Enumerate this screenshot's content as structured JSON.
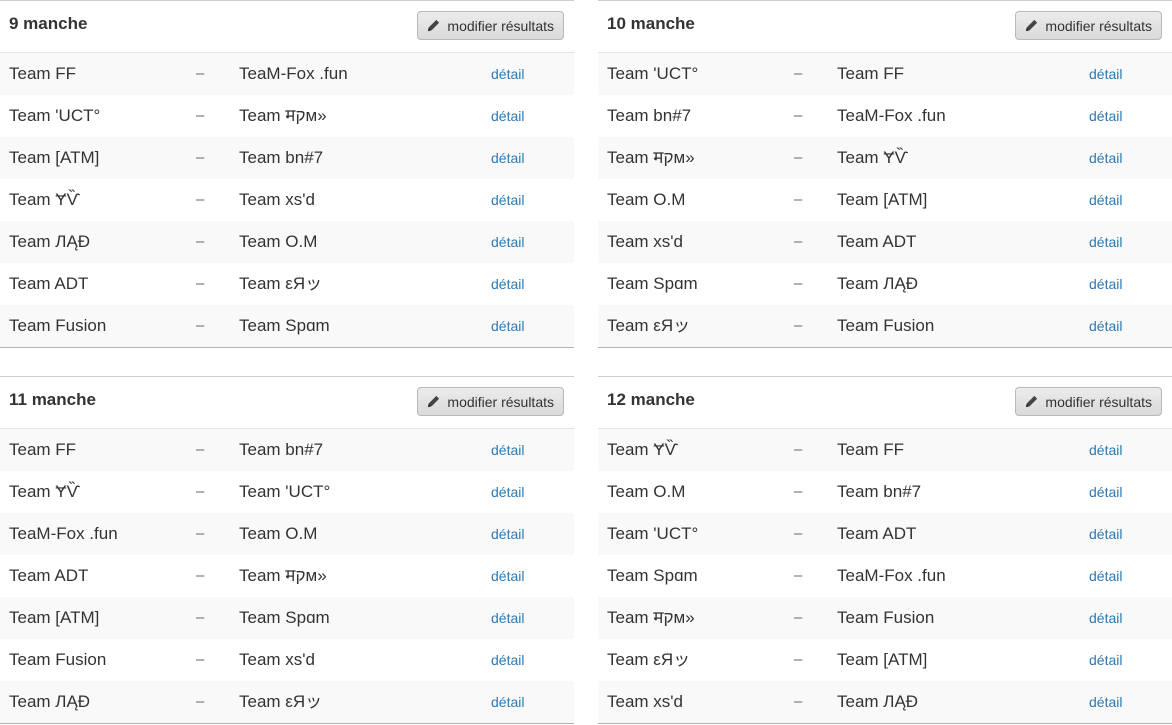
{
  "rounds": [
    {
      "title": "9 manche",
      "edit_label": "modifier résultats",
      "detail_label": "détail",
      "matches": [
        {
          "home": "Team FF",
          "away": "TeaM-Fox .fun"
        },
        {
          "home": "Team 'UCT°",
          "away": "Team मקм»"
        },
        {
          "home": "Team [ATM]",
          "away": "Team bn#7"
        },
        {
          "home": "Team ɎѶ",
          "away": "Team xs'd"
        },
        {
          "home": "Team ЛĄĐ",
          "away": "Team O.M"
        },
        {
          "home": "Team ADT",
          "away": "Team εЯッ"
        },
        {
          "home": "Team Fusion",
          "away": "Team Spɑm"
        }
      ]
    },
    {
      "title": "10 manche",
      "edit_label": "modifier résultats",
      "detail_label": "détail",
      "matches": [
        {
          "home": "Team 'UCT°",
          "away": "Team FF"
        },
        {
          "home": "Team bn#7",
          "away": "TeaM-Fox .fun"
        },
        {
          "home": "Team मקм»",
          "away": "Team ɎѶ"
        },
        {
          "home": "Team O.M",
          "away": "Team [ATM]"
        },
        {
          "home": "Team xs'd",
          "away": "Team ADT"
        },
        {
          "home": "Team Spɑm",
          "away": "Team ЛĄĐ"
        },
        {
          "home": "Team εЯッ",
          "away": "Team Fusion"
        }
      ]
    },
    {
      "title": "11 manche",
      "edit_label": "modifier résultats",
      "detail_label": "détail",
      "matches": [
        {
          "home": "Team FF",
          "away": "Team bn#7"
        },
        {
          "home": "Team ɎѶ",
          "away": "Team 'UCT°"
        },
        {
          "home": "TeaM-Fox .fun",
          "away": "Team O.M"
        },
        {
          "home": "Team ADT",
          "away": "Team मקм»"
        },
        {
          "home": "Team [ATM]",
          "away": "Team Spɑm"
        },
        {
          "home": "Team Fusion",
          "away": "Team xs'd"
        },
        {
          "home": "Team ЛĄĐ",
          "away": "Team εЯッ"
        }
      ]
    },
    {
      "title": "12 manche",
      "edit_label": "modifier résultats",
      "detail_label": "détail",
      "matches": [
        {
          "home": "Team ɎѶ",
          "away": "Team FF"
        },
        {
          "home": "Team O.M",
          "away": "Team bn#7"
        },
        {
          "home": "Team 'UCT°",
          "away": "Team ADT"
        },
        {
          "home": "Team Spɑm",
          "away": "TeaM-Fox .fun"
        },
        {
          "home": "Team मקм»",
          "away": "Team Fusion"
        },
        {
          "home": "Team εЯッ",
          "away": "Team [ATM]"
        },
        {
          "home": "Team xs'd",
          "away": "Team ЛĄĐ"
        }
      ]
    }
  ],
  "separator": "–",
  "colors": {
    "link": "#2a7ab5",
    "row_alt": "#f9f9f9",
    "text": "#333333"
  },
  "icons": {
    "edit": "pencil-icon"
  }
}
